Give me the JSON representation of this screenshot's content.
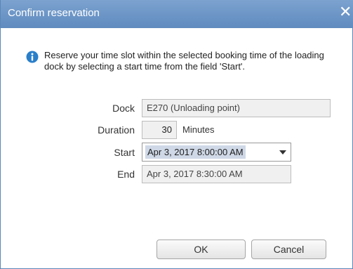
{
  "window": {
    "title": "Confirm reservation",
    "close_glyph": "✕"
  },
  "info": {
    "icon": "info-icon",
    "message": "Reserve your time slot within the selected booking time of the loading dock by selecting a start time from the field 'Start'."
  },
  "form": {
    "dock_label": "Dock",
    "dock_value": "E270 (Unloading point)",
    "duration_label": "Duration",
    "duration_value": "30",
    "duration_unit": "Minutes",
    "start_label": "Start",
    "start_value": "Apr 3, 2017 8:00:00 AM",
    "end_label": "End",
    "end_value": "Apr 3, 2017 8:30:00 AM"
  },
  "buttons": {
    "ok": "OK",
    "cancel": "Cancel"
  },
  "colors": {
    "titlebar": "#6f96c6",
    "info": "#2a7fc9",
    "selection": "#cfd8e6"
  }
}
